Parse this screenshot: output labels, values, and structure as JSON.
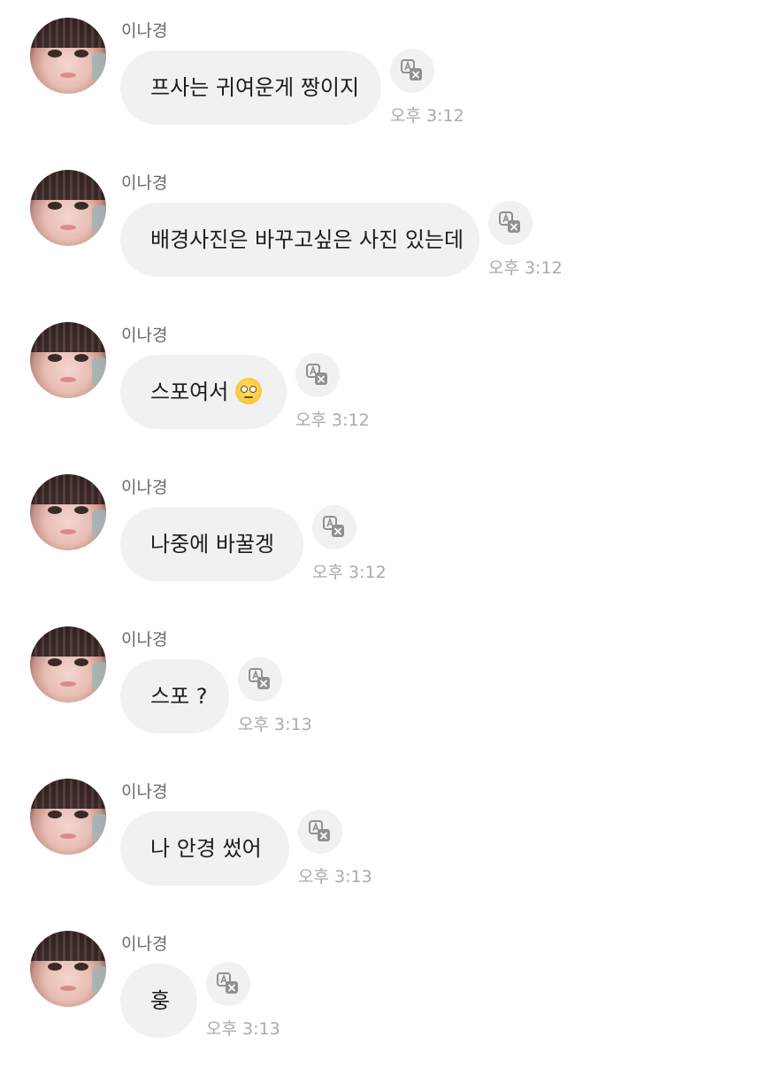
{
  "icons": {
    "avatar": "profile-photo",
    "translate": "translate-icon"
  },
  "colors": {
    "bubble_bg": "#f1f1f4",
    "time_text": "#a7aab0",
    "sender_text": "#666a70"
  },
  "messages": [
    {
      "sender": "이나경",
      "text": "프사는 귀여운게 짱이지",
      "emoji": "",
      "time": "오후 3:12"
    },
    {
      "sender": "이나경",
      "text": "배경사진은 바꾸고싶은 사진 있는데",
      "emoji": "",
      "time": "오후 3:12"
    },
    {
      "sender": "이나경",
      "text": "스포여서",
      "emoji": "face-with-rolling-eyes",
      "time": "오후 3:12"
    },
    {
      "sender": "이나경",
      "text": "나중에 바꿀겡",
      "emoji": "",
      "time": "오후 3:12"
    },
    {
      "sender": "이나경",
      "text": "스포 ?",
      "emoji": "",
      "time": "오후 3:13"
    },
    {
      "sender": "이나경",
      "text": "나 안경 썼어",
      "emoji": "",
      "time": "오후 3:13"
    },
    {
      "sender": "이나경",
      "text": "훙",
      "emoji": "",
      "time": "오후 3:13"
    }
  ]
}
